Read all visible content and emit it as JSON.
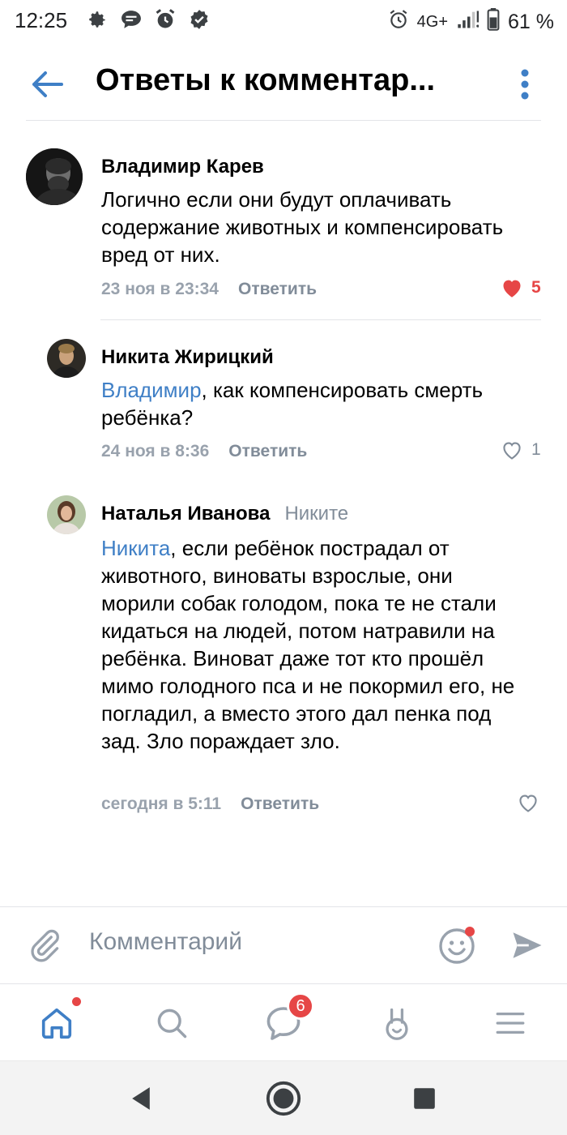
{
  "status_bar": {
    "time": "12:25",
    "network": "4G+",
    "battery": "61 %",
    "icons": [
      "settings-icon",
      "chat-bubble-icon",
      "alarm-clock-icon",
      "verified-badge-icon",
      "alarm-icon",
      "signal-icon",
      "battery-icon"
    ]
  },
  "header": {
    "title": "Ответы к комментар..."
  },
  "comments": [
    {
      "author": "Владимир Карев",
      "reply_to": "",
      "mention": "",
      "text": "Логично если они будут оплачивать содержание животных и компенсировать вред от них.",
      "date": "23 ноя в 23:34",
      "reply_label": "Ответить",
      "likes": "5",
      "liked": true
    },
    {
      "author": "Никита Жирицкий",
      "reply_to": "",
      "mention": "Владимир",
      "text": ", как компенсировать смерть ребёнка?",
      "date": "24 ноя в 8:36",
      "reply_label": "Ответить",
      "likes": "1",
      "liked": false
    },
    {
      "author": "Наталья Иванова",
      "reply_to": "Никите",
      "mention": "Никита",
      "text": ", если ребёнок пострадал от животного, виноваты взрослые, они морили собак голодом, пока те не стали кидаться на людей, потом натравили на ребёнка. Виноват даже тот кто прошёл мимо голодного пса и не покормил его, не погладил, а вместо этого дал пенка под зад. Зло пораждает зло.",
      "date": "сегодня в 5:11",
      "reply_label": "Ответить",
      "likes": "",
      "liked": false
    }
  ],
  "composer": {
    "placeholder": "Комментарий"
  },
  "tabbar": {
    "messages_badge": "6"
  },
  "colors": {
    "accent": "#3f7fc6",
    "like_red": "#e64646",
    "secondary_text": "#818c99"
  }
}
